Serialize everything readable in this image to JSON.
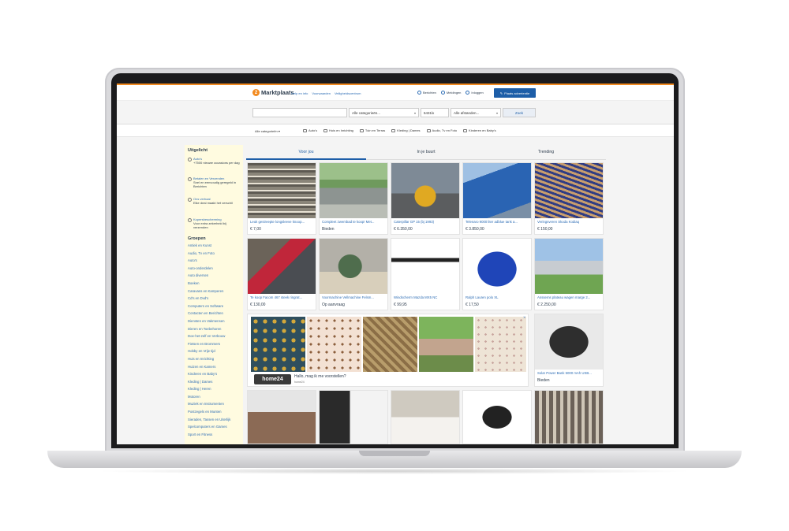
{
  "header": {
    "logo": "Marktplaats",
    "logo_mark": "2",
    "links": [
      "Help en info",
      "Voorwaarden",
      "Veiligheidscentrum"
    ],
    "berichten": "Berichten",
    "meldingen": "Meldingen",
    "inloggen": "Inloggen",
    "place_ad": "Plaats advertentie"
  },
  "search": {
    "category": "Alle categorieën...",
    "zip": "6431lx",
    "distance": "Alle afstanden...",
    "button": "Zoek"
  },
  "catbar": {
    "all": "Alle categorieën",
    "items": [
      "Auto's",
      "Huis en Inrichting",
      "Tuin en Terras",
      "Kleding | Dames",
      "Audio, Tv en Foto",
      "Kinderen en Baby's"
    ]
  },
  "sidebar": {
    "featured_title": "Uitgelicht",
    "featured": [
      {
        "link": "Auto's",
        "text": "+7500 nieuwe occasions per dag"
      },
      {
        "link": "Betalen en Verzenden",
        "text": "Snel en eenvoudig geregeld in Berichten"
      },
      {
        "link": "Ons verhaal",
        "text": "Elke deal maakt het verschil"
      },
      {
        "link": "Kopersbescherming",
        "text": "Voor extra zekerheid bij verzenden"
      }
    ],
    "groups_title": "Groepen",
    "groups": [
      "Antiek en Kunst",
      "Audio, Tv en Foto",
      "Auto's",
      "Auto-onderdelen",
      "Auto diversen",
      "Boeken",
      "Caravans en Kamperen",
      "Cd's en Dvd's",
      "Computers en Software",
      "Contacten en Berichten",
      "Diensten en Vakmensen",
      "Dieren en Toebehoren",
      "Doe-het-zelf en Verbouw",
      "Fietsen en Brommers",
      "Hobby en Vrije tijd",
      "Huis en Inrichting",
      "Huizen en Kamers",
      "Kinderen en Baby's",
      "Kleding | Dames",
      "Kleding | Heren",
      "Motoren",
      "Muziek en Instrumenten",
      "Postzegels en Munten",
      "Sieraden, Tassen en Uiterlijk",
      "Spelcomputers en Games",
      "Sport en Fitness"
    ]
  },
  "tabs": [
    "Voor jou",
    "In je buurt",
    "Trending"
  ],
  "listings": [
    {
      "title": "Leuk gestreepte longsleeve knoop...",
      "price": "€ 7,00"
    },
    {
      "title": "Compleet zwembad te koop! Met...",
      "price": "Bieden"
    },
    {
      "title": "Caterpillar GP 15 (bj 1993)",
      "price": "€ 6.350,00"
    },
    {
      "title": "Telenaro 9000 liter adblue tank a...",
      "price": "€ 3.850,00"
    },
    {
      "title": "Veringsveren Skoda Kodiaq",
      "price": "€ 150,00"
    },
    {
      "title": "Te koop Facom 467 steek ringrat...",
      "price": "€ 130,00"
    },
    {
      "title": "Voormachine Vellmachine Felsm...",
      "price": "Op aanvraag"
    },
    {
      "title": "Windscherm Mazda MX5 NC",
      "price": "€ 99,95"
    },
    {
      "title": "Ralph Lauren polo XL",
      "price": "€ 17,50"
    },
    {
      "title": "Anssems plateau wagen marge 2...",
      "price": "€ 2.250,00"
    },
    {
      "title": "Solar Power Bank 5000 mAh USB...",
      "price": "Bieden"
    }
  ],
  "ad": {
    "brand": "home24",
    "text": "Hallo, mag ik me voorstellen?",
    "sub": "home24",
    "close": "X"
  },
  "colors": {
    "accent": "#f28a1f",
    "brand_blue": "#1d5ea8",
    "sidebar_bg": "#fffbe0"
  }
}
